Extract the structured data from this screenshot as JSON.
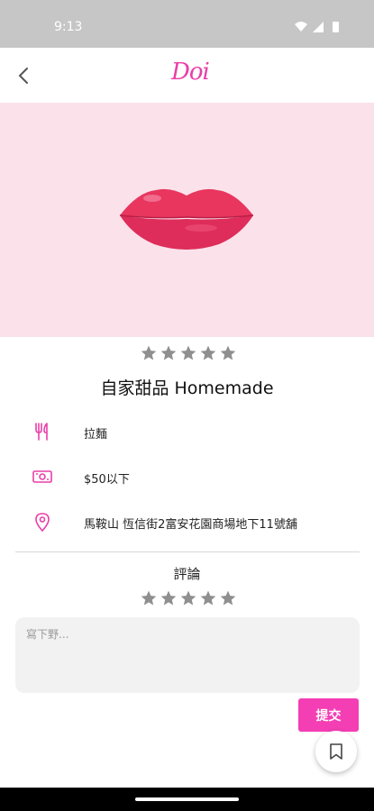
{
  "status_bar": {
    "time": "9:13"
  },
  "app_bar": {
    "logo_text": "Doi"
  },
  "colors": {
    "accent": "#f43eb4",
    "hero_bg": "#fbe1ea",
    "star": "#8f8f8f"
  },
  "shop": {
    "rating": 0,
    "name": "自家甜品 Homemade",
    "category": "拉麵",
    "price": "$50以下",
    "address": "馬鞍山 恆信街2富安花園商場地下11號舖"
  },
  "review": {
    "title": "評論",
    "rating": 0,
    "placeholder": "寫下野...",
    "submit_label": "提交"
  },
  "icons": {
    "back": "back-arrow-icon",
    "category": "utensils-icon",
    "price": "money-icon",
    "address": "location-pin-icon",
    "bookmark": "bookmark-icon"
  }
}
